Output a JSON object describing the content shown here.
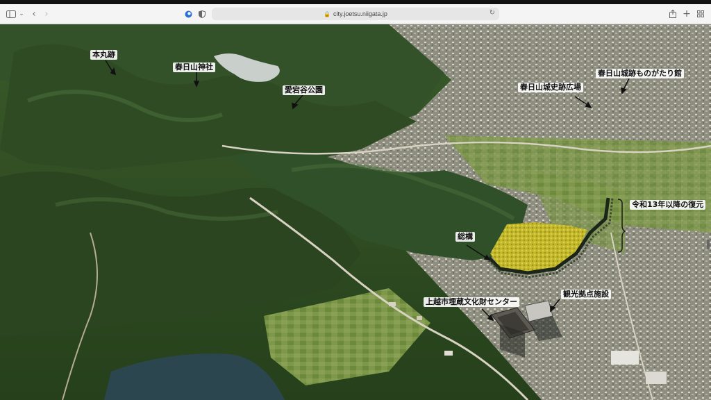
{
  "browser": {
    "url": "city.joetsu.niigata.jp",
    "icons": [
      "sidebar-icon",
      "chevron-down-icon",
      "back-icon",
      "forward-icon",
      "extension-icon",
      "shield-icon",
      "lock-icon",
      "reload-icon",
      "share-icon",
      "new-tab-icon",
      "tab-overview-icon"
    ]
  },
  "map": {
    "labels": {
      "honmaru": "本丸跡",
      "kasugayama_shrine": "春日山神社",
      "atagodani_park": "愛宕谷公園",
      "historic_plaza": "春日山城史跡広場",
      "story_hall": "春日山城跡ものがたり館",
      "restoration": "令和13年以降の復元",
      "sougamae": "総構",
      "tourism_facility": "観光拠点施設",
      "cultural_center": "上越市埋蔵文化財センター"
    },
    "colors": {
      "forest": "#2f4a22",
      "urban": "#8a8a7e",
      "water": "#2c4650",
      "fields": "#7d9a4a",
      "restored_area": "#c7bb2c"
    }
  }
}
